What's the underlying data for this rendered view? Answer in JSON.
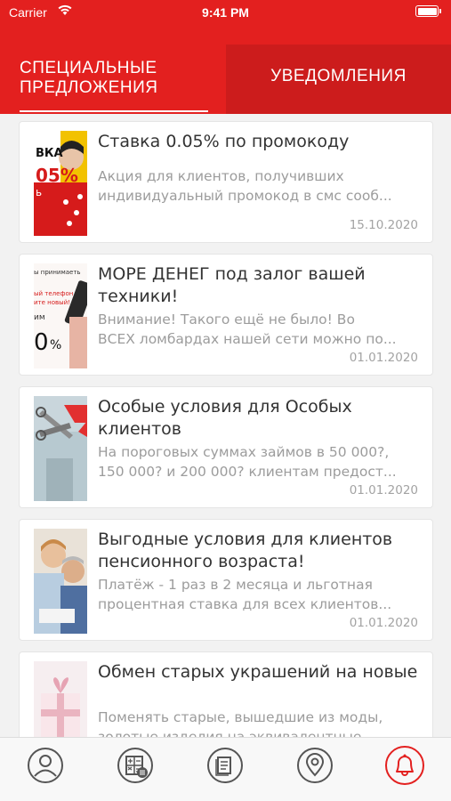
{
  "status_bar": {
    "carrier": "Carrier",
    "time": "9:41 PM"
  },
  "tabs": {
    "offers_line1": "СПЕЦИАЛЬНЫЕ",
    "offers_line2": "ПРЕДЛОЖЕНИЯ",
    "notifications": "УВЕДОМЛЕНИЯ"
  },
  "colors": {
    "brand_red": "#e3201f",
    "tab_dark_red": "#cc1c1c"
  },
  "cards": [
    {
      "title": "Ставка 0.05% по промокоду",
      "desc_line1": "Акция для клиентов, получивших",
      "desc_line2": "индивидуальный промокод в смс сооб...",
      "date": "15.10.2020",
      "thumb_text1": "ВКА",
      "thumb_text2": "05%",
      "thumb_text3": "ь"
    },
    {
      "title": "МОРЕ ДЕНЕГ под залог вашей техники!",
      "desc_line1": "Внимание! Такого ещё не было! Во",
      "desc_line2": "ВСЕХ ломбардах нашей сети можно по...",
      "date": "01.01.2020",
      "thumb_text1": "ы принимаеть",
      "thumb_text2": "ый телефон",
      "thumb_text3": "ите новый!",
      "thumb_text4": "им",
      "thumb_text5": "0",
      "thumb_text6": "%"
    },
    {
      "title": "Особые условия для Особых клиентов",
      "desc_line1": "На пороговых суммах займов в 50 000?,",
      "desc_line2": "150 000? и 200 000? клиентам предост...",
      "date": "01.01.2020"
    },
    {
      "title": "Выгодные условия для клиентов пенсионного возраста!",
      "desc_line1": "Платёж - 1 раз в 2 месяца и льготная",
      "desc_line2": "процентная ставка для всех клиентов...",
      "date": "01.01.2020"
    },
    {
      "title": "Обмен старых украшений на новые",
      "desc_line1": "Поменять старые, вышедшие из моды,",
      "desc_line2": "золотые изделия на эквивалентные",
      "date": ""
    }
  ],
  "tabbar": [
    "profile-icon",
    "calculator-icon",
    "document-icon",
    "location-pin-icon",
    "bell-icon"
  ]
}
